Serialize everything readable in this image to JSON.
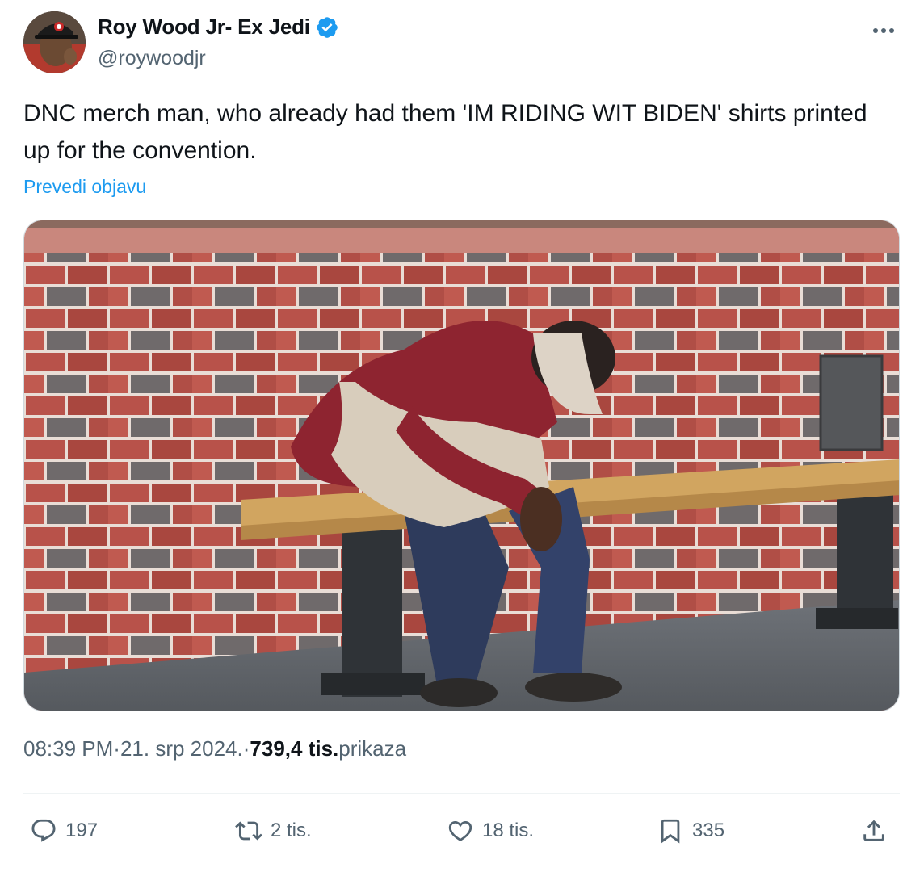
{
  "author": {
    "display_name": "Roy Wood Jr- Ex Jedi",
    "handle": "@roywoodjr",
    "verified": true
  },
  "tweet": {
    "text": "DNC merch man, who already had them 'IM RIDING WIT BIDEN' shirts printed up for the convention.",
    "translate_label": "Prevedi objavu"
  },
  "meta": {
    "time": "08:39 PM",
    "separator": " · ",
    "date": "21. srp 2024.",
    "views_count": "739,4 tis.",
    "views_label": " prikaza"
  },
  "actions": {
    "replies": "197",
    "reposts": "2 tis.",
    "likes": "18 tis.",
    "bookmarks": "335"
  },
  "icons": {
    "more": "more-horizontal-icon",
    "reply": "reply-icon",
    "repost": "repost-icon",
    "like": "heart-icon",
    "bookmark": "bookmark-icon",
    "share": "share-icon",
    "verified": "verified-badge-icon"
  },
  "colors": {
    "accent": "#1d9bf0",
    "text_primary": "#0f1419",
    "text_secondary": "#536471",
    "divider": "#eff3f4"
  }
}
